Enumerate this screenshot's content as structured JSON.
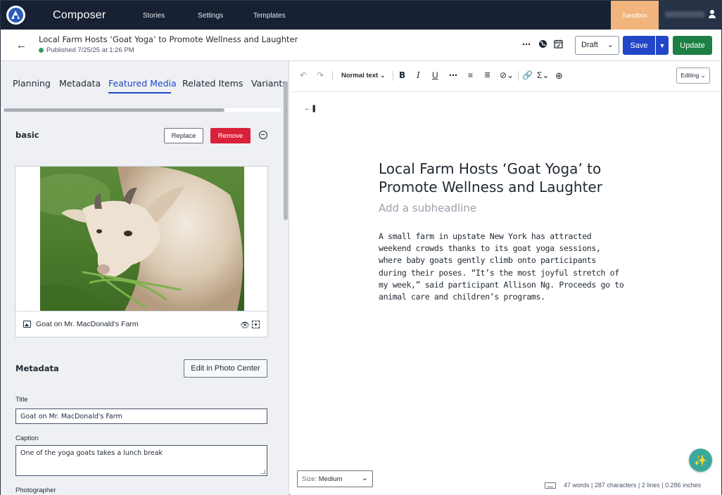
{
  "app": {
    "name": "Composer"
  },
  "nav": {
    "items": [
      "Stories",
      "Settings",
      "Templates"
    ],
    "sandbox_label": "Sandbox"
  },
  "header": {
    "title": "Local Farm Hosts ‘Goat Yoga’ to Promote Wellness and Laughter",
    "status": "Published 7/25/25 at 1:26 PM",
    "status_color": "#2f9e63",
    "draft_value": "Draft",
    "save_label": "Save",
    "update_label": "Update"
  },
  "panel": {
    "tabs": [
      "Planning",
      "Metadata",
      "Featured Media",
      "Related Items",
      "Variants"
    ],
    "active_tab": "Featured Media",
    "media_section_label": "basic",
    "replace_label": "Replace",
    "remove_label": "Remove",
    "media_name": "Goat on Mr. MacDonald's Farm",
    "metadata_heading": "Metadata",
    "edit_photo_label": "Edit in Photo Center",
    "fields": {
      "title_label": "Title",
      "title_value": "Goat on Mr. MacDonald's Farm",
      "caption_label": "Caption",
      "caption_value": "One of the yoga goats takes a lunch break",
      "photographer_label": "Photographer"
    }
  },
  "editor": {
    "toolbar": {
      "style_label": "Normal text ⌄",
      "mode_label": "Editing ⌄"
    },
    "headline": "Local Farm Hosts ‘Goat Yoga’ to Promote Wellness and Laughter",
    "subheadline_placeholder": "Add a subheadline",
    "body": "A small farm in upstate New York has attracted weekend crowds thanks to its goat yoga sessions, where baby goats gently climb onto participants during their poses. “It’s the most joyful stretch of my week,” said participant Allison Ng. Proceeds go to animal care and children’s programs.",
    "size_label": "Size:",
    "size_value": "Medium",
    "stats": "47 words | 287 characters | 2 lines | 0.286 inches"
  },
  "colors": {
    "nav_bg": "#172133",
    "primary": "#2146c7",
    "success": "#1d7f43",
    "danger": "#d9213a",
    "sandbox": "#f0b47c"
  }
}
